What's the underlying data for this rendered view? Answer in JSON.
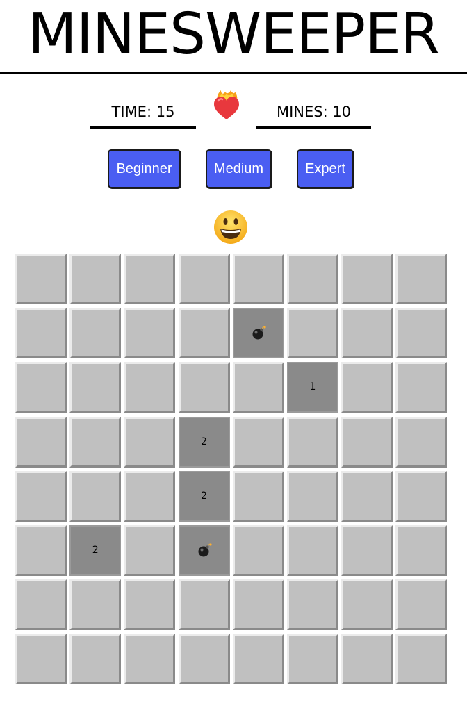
{
  "header": {
    "title": "MINESWEEPER"
  },
  "stats": {
    "time_label": "TIME: 15",
    "mines_label": "MINES: 10"
  },
  "icons": {
    "status": "flaming-heart-icon",
    "reset": "smiley-face-icon",
    "mine": "bomb-icon"
  },
  "difficulty": {
    "beginner": "Beginner",
    "medium": "Medium",
    "expert": "Expert"
  },
  "colors": {
    "button": "#4a5ef2",
    "cell_hidden": "#c0c0c0",
    "cell_revealed": "#8a8a8a"
  },
  "board": {
    "rows": 8,
    "cols": 8,
    "cells": [
      [
        "",
        "",
        "",
        "",
        "",
        "",
        "",
        ""
      ],
      [
        "",
        "",
        "",
        "",
        "bomb",
        "",
        "",
        ""
      ],
      [
        "",
        "",
        "",
        "",
        "",
        "1",
        "",
        ""
      ],
      [
        "",
        "",
        "",
        "2",
        "",
        "",
        "",
        ""
      ],
      [
        "",
        "",
        "",
        "2",
        "",
        "",
        "",
        ""
      ],
      [
        "",
        "2",
        "",
        "bomb",
        "",
        "",
        "",
        ""
      ],
      [
        "",
        "",
        "",
        "",
        "",
        "",
        "",
        ""
      ],
      [
        "",
        "",
        "",
        "",
        "",
        "",
        "",
        ""
      ]
    ]
  }
}
